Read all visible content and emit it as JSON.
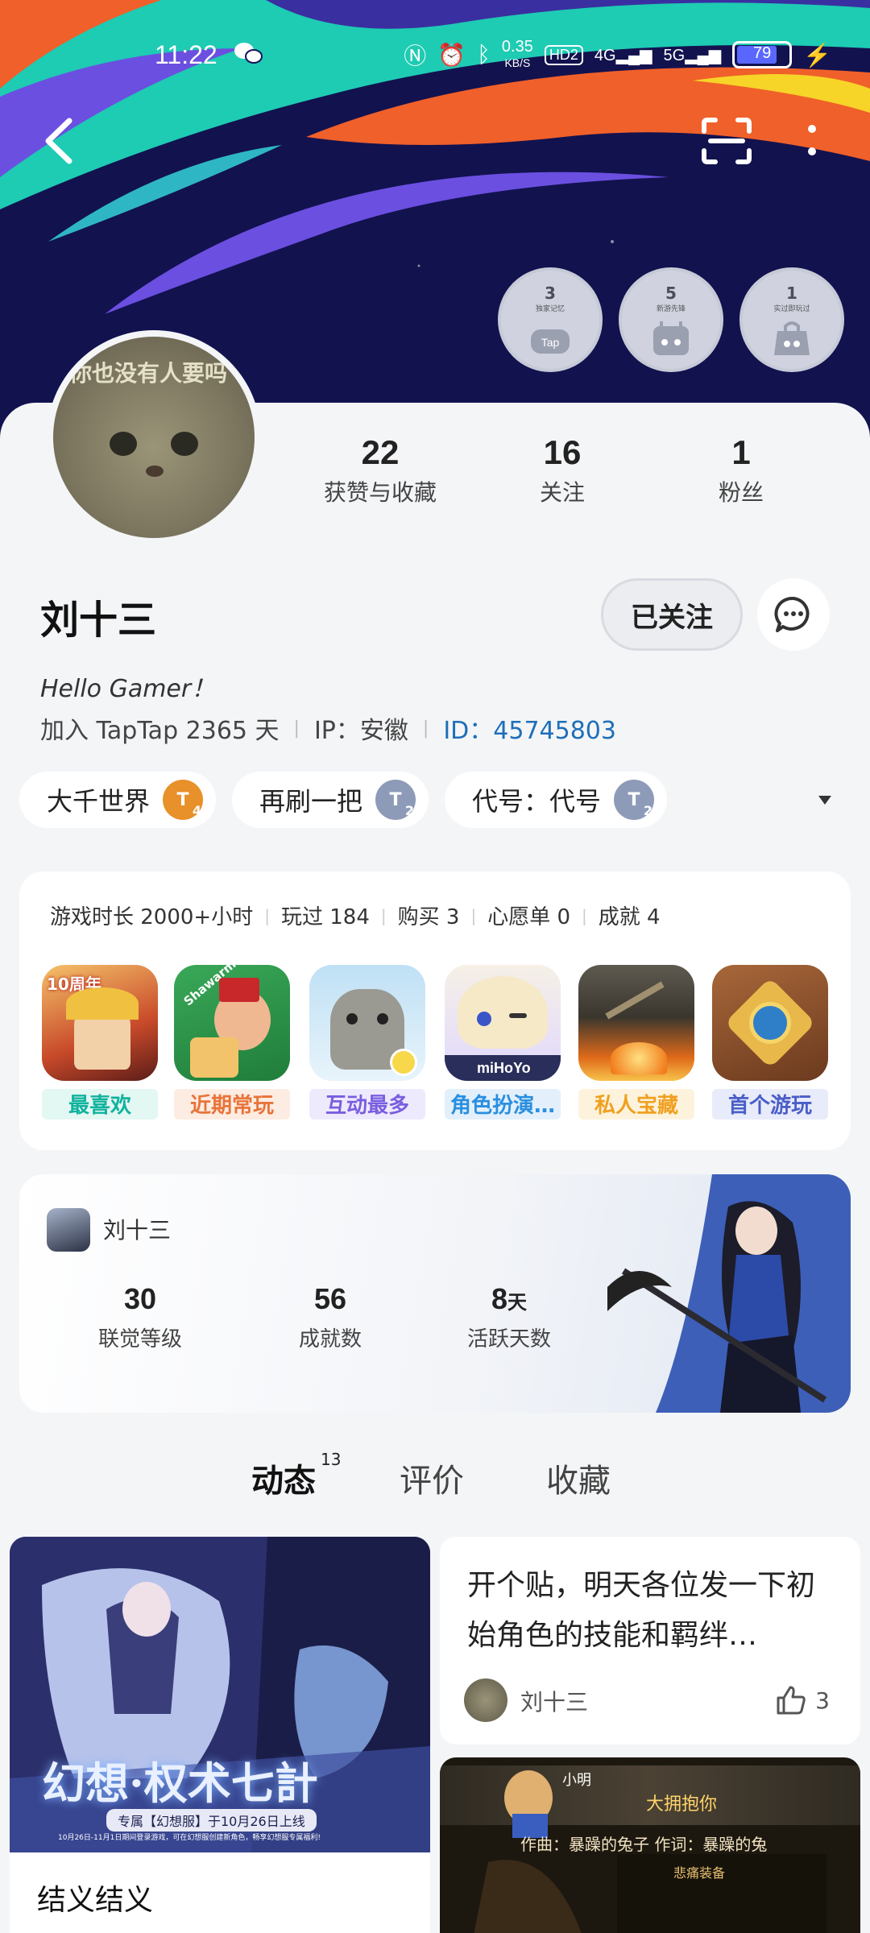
{
  "status_bar": {
    "time": "11:22",
    "speed_value": "0.35",
    "speed_unit": "KB/S",
    "hd": "HD2",
    "net1": "4G",
    "net2": "5G",
    "battery": "79",
    "battery_level": 0.79
  },
  "badges": [
    {
      "count": "3",
      "label": "独家记忆"
    },
    {
      "count": "5",
      "label": "新游先锋"
    },
    {
      "count": "1",
      "label": "实过即玩过"
    }
  ],
  "profile": {
    "avatar_caption": "你也没有人要吗",
    "name": "刘十三",
    "bio": "Hello Gamer！",
    "joined": "加入 TapTap 2365 天",
    "ip": "IP：安徽",
    "id": "ID：45745803",
    "follow_button": "已关注"
  },
  "stats": [
    {
      "value": "22",
      "label": "获赞与收藏"
    },
    {
      "value": "16",
      "label": "关注"
    },
    {
      "value": "1",
      "label": "粉丝"
    }
  ],
  "tags": [
    {
      "label": "大千世界",
      "level": "T",
      "level_num": "4",
      "color": "#e8902a"
    },
    {
      "label": "再刷一把",
      "level": "T",
      "level_num": "2",
      "color": "#8d9bb8"
    },
    {
      "label": "代号：代号",
      "level": "T",
      "level_num": "2",
      "color": "#8d9bb8"
    }
  ],
  "games": {
    "summary": [
      "游戏时长 2000+小时",
      "玩过 184",
      "购买 3",
      "心愿单 0",
      "成就 4"
    ],
    "items": [
      {
        "label": "最喜欢",
        "color": "#10b39d",
        "bg": "#e3f7f3",
        "icon_text": "10周年"
      },
      {
        "label": "近期常玩",
        "color": "#e8743a",
        "bg": "#fdece2",
        "icon_text": "Shawarma"
      },
      {
        "label": "互动最多",
        "color": "#7a5ee0",
        "bg": "#eeeafd",
        "icon_text": ""
      },
      {
        "label": "角色扮演…",
        "color": "#2a8fe0",
        "bg": "#e3f0fc",
        "icon_text": "miHoYo"
      },
      {
        "label": "私人宝藏",
        "color": "#f0a020",
        "bg": "#fdf3dd",
        "icon_text": ""
      },
      {
        "label": "首个游玩",
        "color": "#4a5ec8",
        "bg": "#e8ebfa",
        "icon_text": ""
      }
    ]
  },
  "linked": {
    "name": "刘十三",
    "stats": [
      {
        "value": "30",
        "unit": "",
        "label": "联觉等级"
      },
      {
        "value": "56",
        "unit": "",
        "label": "成就数"
      },
      {
        "value": "8",
        "unit": "天",
        "label": "活跃天数"
      }
    ]
  },
  "tabs": [
    {
      "label": "动态",
      "count": "13"
    },
    {
      "label": "评价",
      "count": ""
    },
    {
      "label": "收藏",
      "count": ""
    }
  ],
  "feed": {
    "post1": {
      "cover_title": "幻想·权术七計",
      "cover_subtitle": "专属【幻想服】于10月26日上线",
      "cover_fine": "10月26日-11月1日期间登录游戏，可在幻想服创建新角色，畅享幻想服专属福利!",
      "title": "结义结义"
    },
    "post2": {
      "text": "开个贴，明天各位发一下初始角色的技能和羁绊…",
      "author": "刘十三",
      "likes": "3"
    },
    "post3": {
      "user": "小明",
      "line1": "大拥抱你",
      "line2": "作曲：暴躁的兔子 作词：暴躁的兔",
      "label": "悲痛装备"
    }
  }
}
